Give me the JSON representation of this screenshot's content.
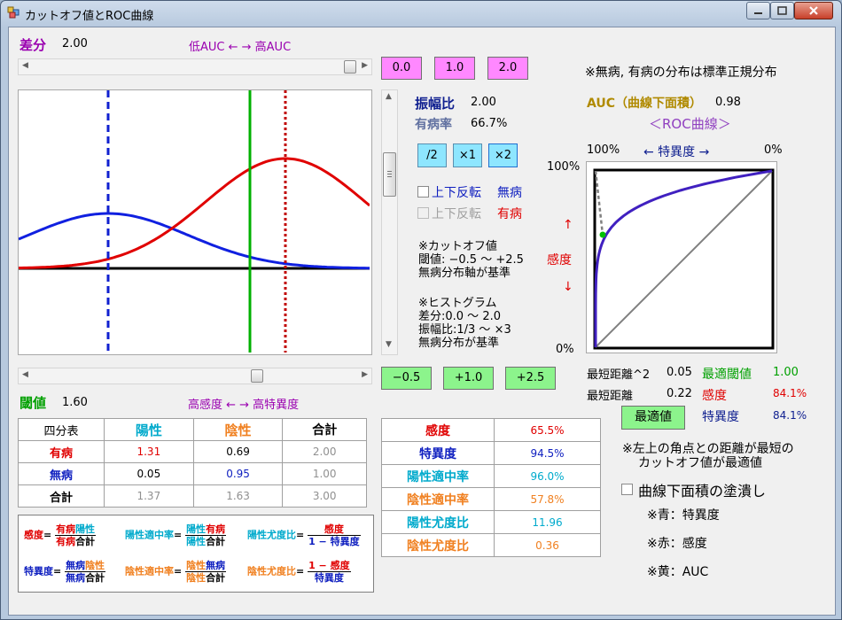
{
  "window": {
    "title": "カットオフ値とROC曲線"
  },
  "colors": {
    "pink": "#ff88ff",
    "cyan": "#8ee6ff",
    "green": "#8cf48c",
    "red": "#e00000",
    "blue": "#1020c0",
    "aqua": "#00aacc",
    "orange": "#f08020",
    "olive": "#b08a00",
    "purple": "#9040c0"
  },
  "top": {
    "diff_label": "差分",
    "diff_value": "2.00",
    "range_label": "低AUC ← → 高AUC",
    "diff_slider_fraction": 1.0,
    "buttons": [
      "0.0",
      "1.0",
      "2.0"
    ],
    "note": "※無病, 有病の分布は標準正規分布"
  },
  "amp": {
    "label": "振幅比",
    "value": "2.00",
    "prev_label": "有病率",
    "prev_value": "66.7%",
    "buttons": [
      "/2",
      "×1",
      "×2"
    ]
  },
  "flip": [
    {
      "text": "上下反転",
      "state": "無病",
      "enabled": true
    },
    {
      "text": "上下反転",
      "state": "有病",
      "enabled": false
    }
  ],
  "notes": {
    "cutoff": [
      "※カットオフ値",
      "閾値: −0.5 〜 +2.5",
      "無病分布軸が基準"
    ],
    "hist": [
      "※ヒストグラム",
      "差分:0.0 〜 2.0",
      "振幅比:1/3 〜 ×3",
      "無病分布が基準"
    ]
  },
  "threshold": {
    "label": "閾値",
    "value": "1.60",
    "range_label": "高感度 ← → 高特異度",
    "slider_fraction": 0.7,
    "buttons": [
      "−0.5",
      "+1.0",
      "+2.5"
    ]
  },
  "auc": {
    "label": "AUC（曲線下面積）",
    "value": "0.98",
    "roc_title": "＜ROC曲線＞",
    "spec_left": "100%",
    "spec_label": "← 特異度 →",
    "spec_right": "0%",
    "sens_top": "100%",
    "sens_bottom": "0%",
    "sens_up": "↑",
    "sens_label": "感度",
    "sens_down": "↓"
  },
  "metrics": {
    "dist2_label": "最短距離^2",
    "dist2_value": "0.05",
    "opt_label": "最適閾値",
    "opt_value": "1.00",
    "dist_label": "最短距離",
    "dist_value": "0.22",
    "sens_label": "感度",
    "sens_value": "84.1%",
    "spec_label": "特異度",
    "spec_value": "84.1%",
    "opt_button": "最適値",
    "note1": "※左上の角点との距離が最短の",
    "note2": "カットオフ値が最適値"
  },
  "fill": {
    "label": "曲線下面積の塗潰し",
    "blue": "※青：特異度",
    "red": "※赤：感度",
    "yellow": "※黄：AUC"
  },
  "table4": {
    "headers": [
      "四分表",
      "陽性",
      "陰性",
      "合計"
    ],
    "rows": [
      [
        "有病",
        "1.31",
        "0.69",
        "2.00"
      ],
      [
        "無病",
        "0.05",
        "0.95",
        "1.00"
      ],
      [
        "合計",
        "1.37",
        "1.63",
        "3.00"
      ]
    ]
  },
  "table2": {
    "rows": [
      [
        "感度",
        "65.5%"
      ],
      [
        "特異度",
        "94.5%"
      ],
      [
        "陽性適中率",
        "96.0%"
      ],
      [
        "陰性適中率",
        "57.8%"
      ],
      [
        "陽性尤度比",
        "11.96"
      ],
      [
        "陰性尤度比",
        "0.36"
      ]
    ]
  },
  "formulas": {
    "sens": {
      "lhs": "感度",
      "num": [
        "有病",
        "陽性"
      ],
      "den": [
        "有病",
        "合計"
      ]
    },
    "ppv": {
      "lhs": "陽性適中率",
      "num": [
        "陽性",
        "有病"
      ],
      "den": [
        "陽性",
        "合計"
      ]
    },
    "plr": {
      "lhs": "陽性尤度比",
      "num": "感度",
      "den": "1 − 特異度"
    },
    "spec": {
      "lhs": "特異度",
      "num": [
        "無病",
        "陰性"
      ],
      "den": [
        "無病",
        "合計"
      ]
    },
    "npv": {
      "lhs": "陰性適中率",
      "num": [
        "陰性",
        "無病"
      ],
      "den": [
        "陰性",
        "合計"
      ]
    },
    "nlr": {
      "lhs": "陰性尤度比",
      "num": "1 − 感度",
      "den": "特異度"
    }
  }
}
